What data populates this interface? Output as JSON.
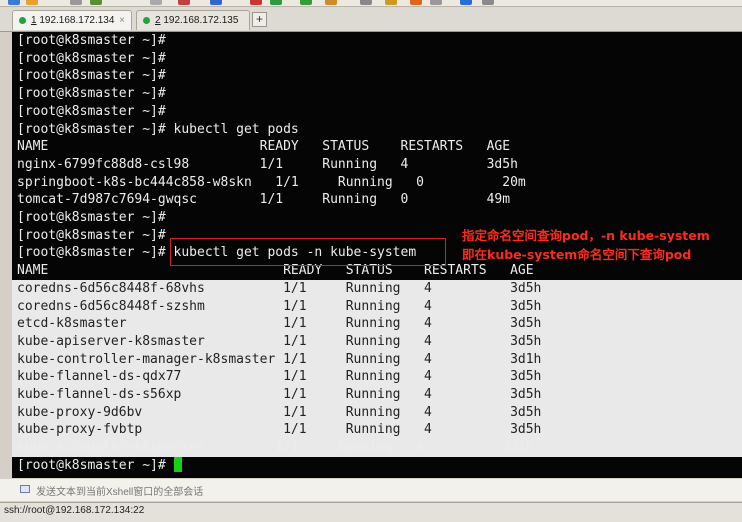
{
  "tabs": [
    {
      "num": "1",
      "label": " 192.168.172.134",
      "close": "×"
    },
    {
      "num": "2",
      "label": " 192.168.172.135",
      "close": ""
    }
  ],
  "new_tab_label": "+",
  "terminal": {
    "lines": [
      "[root@k8smaster ~]#",
      "[root@k8smaster ~]#",
      "[root@k8smaster ~]#",
      "[root@k8smaster ~]#",
      "[root@k8smaster ~]#",
      "[root@k8smaster ~]# kubectl get pods",
      "NAME                           READY   STATUS    RESTARTS   AGE",
      "nginx-6799fc88d8-csl98         1/1     Running   4          3d5h",
      "springboot-k8s-bc444c858-w8skn   1/1     Running   0          20m",
      "tomcat-7d987c7694-gwqsc        1/1     Running   0          49m",
      "[root@k8smaster ~]#",
      "[root@k8smaster ~]#",
      "[root@k8smaster ~]# kubectl get pods -n kube-system",
      "NAME                              READY   STATUS    RESTARTS   AGE",
      "coredns-6d56c8448f-68vhs          1/1     Running   4          3d5h",
      "coredns-6d56c8448f-szshm          1/1     Running   4          3d5h",
      "etcd-k8smaster                    1/1     Running   4          3d5h",
      "kube-apiserver-k8smaster          1/1     Running   4          3d5h",
      "kube-controller-manager-k8smaster 1/1     Running   4          3d1h",
      "kube-flannel-ds-qdx77             1/1     Running   4          3d5h",
      "kube-flannel-ds-s56xp             1/1     Running   4          3d5h",
      "kube-proxy-9d6bv                  1/1     Running   4          3d5h",
      "kube-proxy-fvbtp                  1/1     Running   4          3d5h",
      "kube-scheduler-k8smaster         1/1     Running   4          3d1h",
      "[root@k8smaster ~]#"
    ]
  },
  "annotation": {
    "line1": "指定命名空间查询pod，-n kube-system",
    "line2": "即在kube-system命名空间下查询pod",
    "color": "#ff2a1a"
  },
  "send_bar_text": "发送文本到当前Xshell窗口的全部会话",
  "status_text": "ssh://root@192.168.172.134:22",
  "cursor_color": "#18d018"
}
